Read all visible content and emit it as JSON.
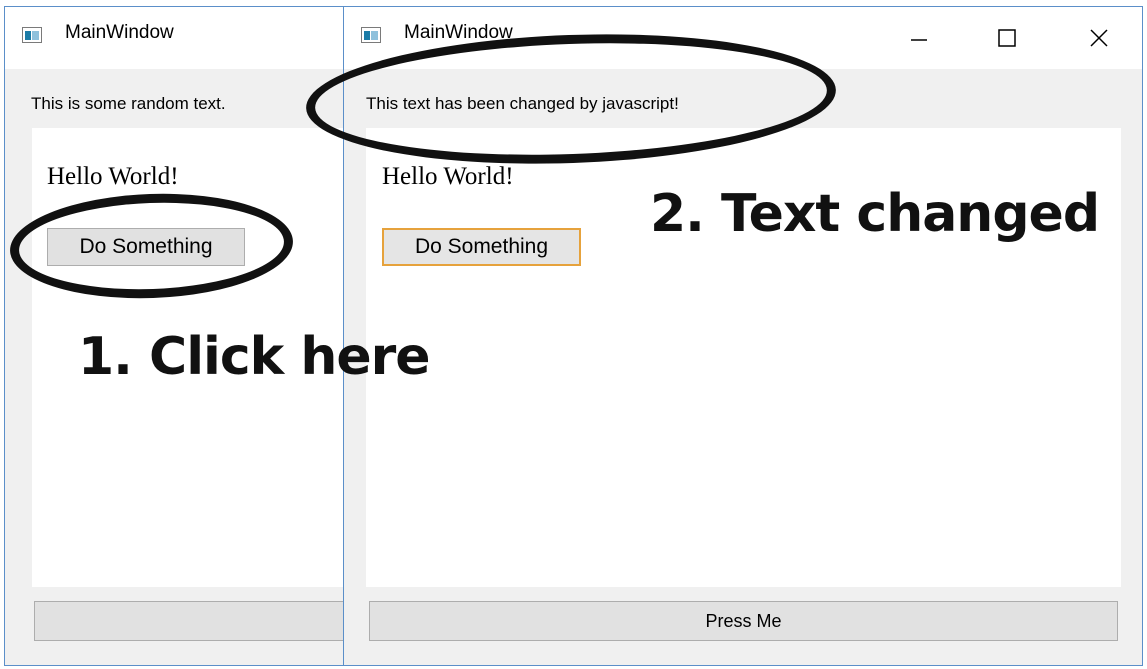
{
  "left_window": {
    "title": "MainWindow",
    "label_text": "This is some random text.",
    "heading": "Hello World!",
    "button_label": "Do Something"
  },
  "right_window": {
    "title": "MainWindow",
    "label_text": "This text has been changed by javascript!",
    "heading": "Hello World!",
    "button_label": "Do Something",
    "press_button_label": "Press Me",
    "controls": [
      "minimize-icon",
      "maximize-icon",
      "close-icon"
    ]
  },
  "annotations": {
    "step1": "1. Click here",
    "step2": "2. Text changed"
  }
}
